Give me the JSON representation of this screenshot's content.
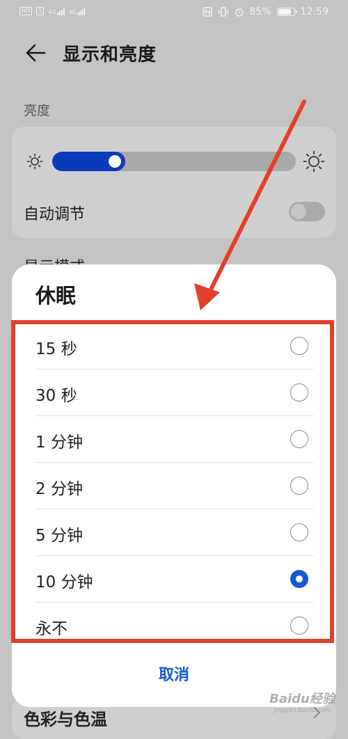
{
  "status": {
    "left_badges": [
      "HD",
      "1"
    ],
    "network_labels": [
      "4G",
      "4G"
    ],
    "battery": "85%",
    "battery_level": 0.85,
    "time": "12:59"
  },
  "header": {
    "title": "显示和亮度"
  },
  "brightness": {
    "section_label": "亮度",
    "level": 0.3,
    "auto_label": "自动调节",
    "auto_enabled": false
  },
  "background": {
    "next_section": "显示模式",
    "bottom_item": "色彩与色温"
  },
  "dialog": {
    "title": "休眠",
    "options": [
      {
        "label": "15 秒",
        "selected": false
      },
      {
        "label": "30 秒",
        "selected": false
      },
      {
        "label": "1 分钟",
        "selected": false
      },
      {
        "label": "2 分钟",
        "selected": false
      },
      {
        "label": "5 分钟",
        "selected": false
      },
      {
        "label": "10 分钟",
        "selected": true
      },
      {
        "label": "永不",
        "selected": false
      }
    ],
    "cancel_label": "取消"
  },
  "watermark": {
    "main": "Baidu经验",
    "sub": "jingyan.baidu.com"
  },
  "colors": {
    "accent": "#1558d6",
    "slider_fill": "#0a3cb9",
    "annotation": "#e1402d"
  }
}
